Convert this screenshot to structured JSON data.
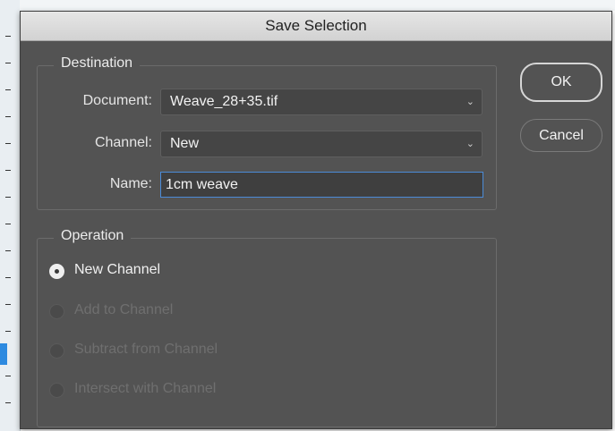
{
  "dialog": {
    "title": "Save Selection"
  },
  "destination": {
    "group_label": "Destination",
    "document_label": "Document:",
    "document_value": "Weave_28+35.tif",
    "channel_label": "Channel:",
    "channel_value": "New",
    "name_label": "Name:",
    "name_value": "1cm weave"
  },
  "operation": {
    "group_label": "Operation",
    "options": [
      {
        "label": "New Channel",
        "selected": true,
        "enabled": true
      },
      {
        "label": "Add to Channel",
        "selected": false,
        "enabled": false
      },
      {
        "label": "Subtract from Channel",
        "selected": false,
        "enabled": false
      },
      {
        "label": "Intersect with Channel",
        "selected": false,
        "enabled": false
      }
    ]
  },
  "buttons": {
    "ok": "OK",
    "cancel": "Cancel"
  },
  "icons": {
    "dropdown": "chevron-down-icon"
  },
  "colors": {
    "dialog_bg": "#535353",
    "focus_border": "#4b8bd8"
  }
}
